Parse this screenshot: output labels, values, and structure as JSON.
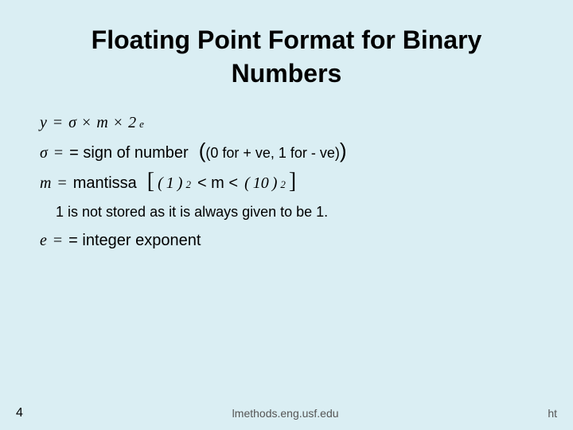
{
  "slide": {
    "title_line1": "Floating Point Format for Binary",
    "title_line2": "Numbers",
    "formula_y": "y = σ × m × 2",
    "formula_y_exp": "e",
    "sigma_label": "σ",
    "sigma_equals": "= sign of number",
    "sigma_paren": "(0 for + ve, 1 for - ve)",
    "m_label": "m",
    "m_equals": "= mantissa",
    "m_bracket_open": "[",
    "m_bracket_val": "(1)",
    "m_bracket_sub": "2",
    "m_lt": "< m <",
    "m_bracket_val2": "(10)",
    "m_bracket_sub2": "2",
    "m_bracket_close": "]",
    "note": "1 is not stored as it is always given to be 1.",
    "e_label": "e",
    "e_equals": "= integer exponent",
    "slide_number": "4",
    "url": "lmethods.eng.usf.edu",
    "ht_text": "ht"
  }
}
